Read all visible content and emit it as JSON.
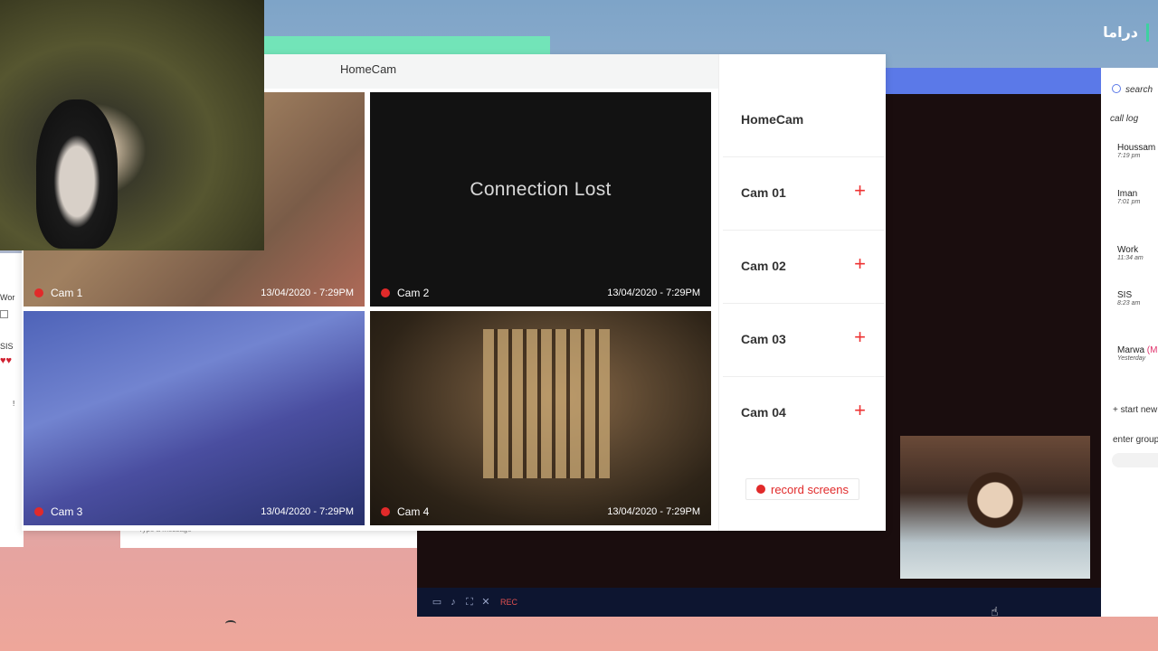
{
  "brand": {
    "name": "دراما",
    "accent": "#3ed1a0"
  },
  "call_toolbar": {
    "rec_label": "REC"
  },
  "chat_panel": {
    "search_label": "search",
    "call_log_label": "call log",
    "contacts": [
      {
        "name": "Houssam",
        "time": "7:19 pm"
      },
      {
        "name": "Iman",
        "time": "7:01 pm"
      },
      {
        "name": "Work",
        "time": "11:34 am"
      },
      {
        "name": "SIS",
        "time": "8:23 am"
      },
      {
        "name": "Marwa",
        "name_suffix": "(M",
        "time": "Yesterday"
      }
    ],
    "start_new_label": "+ start new",
    "enter_group_label": "enter group"
  },
  "left_strip": {
    "text1": "Wor",
    "text2": "SIS",
    "text3": "!",
    "message_placeholder": "Type a message"
  },
  "homecam": {
    "title": "HomeCam",
    "sidebar_title": "HomeCam",
    "cameras": [
      {
        "label": "Cam 1",
        "timestamp": "13/04/2020 - 7:29PM"
      },
      {
        "label": "Cam 2",
        "timestamp": "13/04/2020 - 7:29PM",
        "status": "Connection Lost"
      },
      {
        "label": "Cam 3",
        "timestamp": "13/04/2020 - 7:29PM"
      },
      {
        "label": "Cam 4",
        "timestamp": "13/04/2020 - 7:29PM"
      }
    ],
    "sidebar_items": [
      {
        "label": "Cam 01"
      },
      {
        "label": "Cam 02"
      },
      {
        "label": "Cam 03"
      },
      {
        "label": "Cam 04"
      }
    ],
    "plus_symbol": "+",
    "record_button_label": "record screens",
    "record_color": "#e12a2a"
  }
}
